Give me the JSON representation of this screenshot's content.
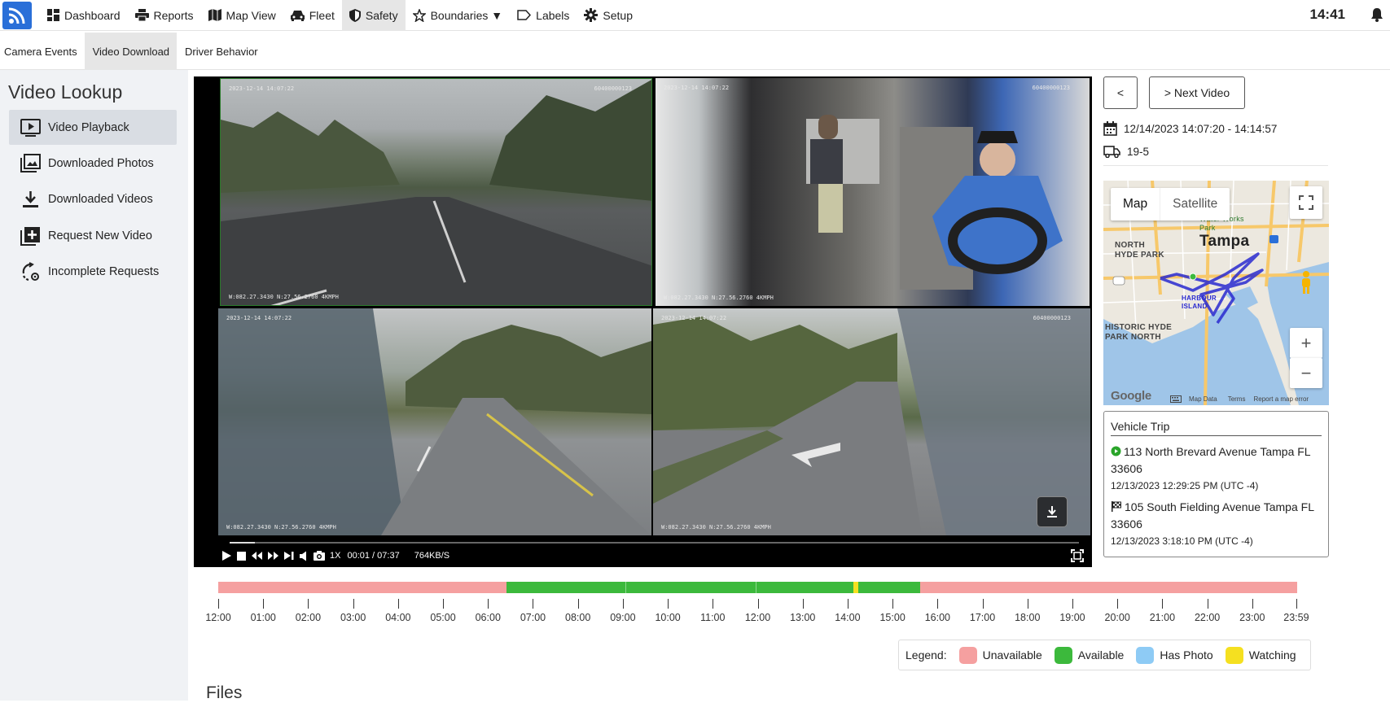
{
  "nav": {
    "items": [
      {
        "label": "Dashboard",
        "icon": "dashboard-icon"
      },
      {
        "label": "Reports",
        "icon": "printer-icon"
      },
      {
        "label": "Map View",
        "icon": "map-icon"
      },
      {
        "label": "Fleet",
        "icon": "car-icon"
      },
      {
        "label": "Safety",
        "icon": "shield-icon"
      },
      {
        "label": "Boundaries ▼",
        "icon": "star-icon"
      },
      {
        "label": "Labels",
        "icon": "tag-icon"
      },
      {
        "label": "Setup",
        "icon": "gear-icon"
      }
    ],
    "active": "Safety",
    "clock": "14:41"
  },
  "subnav": {
    "tabs": [
      "Camera Events",
      "Video Download",
      "Driver Behavior"
    ],
    "active": "Video Download"
  },
  "sidebar": {
    "title": "Video Lookup",
    "items": [
      {
        "label": "Video Playback",
        "icon": "video-playback-icon"
      },
      {
        "label": "Downloaded Photos",
        "icon": "photos-icon"
      },
      {
        "label": "Downloaded Videos",
        "icon": "download-icon"
      },
      {
        "label": "Request New Video",
        "icon": "add-icon"
      },
      {
        "label": "Incomplete Requests",
        "icon": "incomplete-icon"
      }
    ],
    "active": "Video Playback"
  },
  "video": {
    "cameras": [
      {
        "timestamp": "2023-12-14 14:07:22",
        "camera_id": "60400000123",
        "gps": "W:082.27.3430 N:27.56.2760 4KMPH"
      },
      {
        "timestamp": "2023-12-14 14:07:22",
        "camera_id": "60400000123",
        "gps": "W:082.27.3430 N:27.56.2760 4KMPH"
      },
      {
        "timestamp": "2023-12-14 14:07:22",
        "camera_id": "",
        "gps": "W:082.27.3430 N:27.56.2760 4KMPH"
      },
      {
        "timestamp": "2023-12-14 14:07:22",
        "camera_id": "60400000123",
        "gps": "W:082.27.3430 N:27.56.2760 4KMPH"
      }
    ],
    "speed": "1X",
    "time": "00:01 / 07:37",
    "bitrate": "764KB/S",
    "progress_fraction": 0.03
  },
  "right_panel": {
    "prev_label": "<",
    "next_label": "> Next Video",
    "date_range": "12/14/2023 14:07:20 - 14:14:57",
    "vehicle": "19-5"
  },
  "map": {
    "tab_map": "Map",
    "tab_satellite": "Satellite",
    "labels": [
      "Tampa",
      "NORTH HYDE PARK",
      "HISTORIC HYDE PARK NORTH",
      "Water Works Park",
      "HARBOUR ISLAND"
    ],
    "footer": [
      "Map Data",
      "Terms",
      "Report a map error"
    ],
    "google": "Google",
    "route_color": "#2a2ad0"
  },
  "trip": {
    "title": "Vehicle Trip",
    "start_address": "113 North Brevard Avenue Tampa FL 33606",
    "start_time": "12/13/2023 12:29:25 PM (UTC -4)",
    "end_address": "105 South Fielding Avenue Tampa FL 33606",
    "end_time": "12/13/2023 3:18:10 PM (UTC -4)"
  },
  "timeline": {
    "labels": [
      "12:00",
      "01:00",
      "02:00",
      "03:00",
      "04:00",
      "05:00",
      "06:00",
      "07:00",
      "08:00",
      "09:00",
      "10:00",
      "11:00",
      "12:00",
      "13:00",
      "14:00",
      "15:00",
      "16:00",
      "17:00",
      "18:00",
      "19:00",
      "20:00",
      "21:00",
      "22:00",
      "23:00",
      "23:59"
    ],
    "segments": [
      {
        "from_hour": 0,
        "to_hour": 6.42,
        "status": "unavailable"
      },
      {
        "from_hour": 6.42,
        "to_hour": 14.12,
        "status": "available"
      },
      {
        "from_hour": 14.12,
        "to_hour": 14.24,
        "status": "watching"
      },
      {
        "from_hour": 14.24,
        "to_hour": 15.62,
        "status": "available"
      },
      {
        "from_hour": 15.62,
        "to_hour": 24,
        "status": "unavailable"
      }
    ],
    "colors": {
      "unavailable": "#f5a0a0",
      "available": "#3cb93c",
      "has_photo": "#8ecbf5",
      "watching": "#f5e020"
    }
  },
  "legend": {
    "title": "Legend:",
    "items": [
      {
        "label": "Unavailable",
        "color": "#f5a0a0"
      },
      {
        "label": "Available",
        "color": "#3cb93c"
      },
      {
        "label": "Has Photo",
        "color": "#8ecbf5"
      },
      {
        "label": "Watching",
        "color": "#f5e020"
      }
    ]
  },
  "files_title": "Files"
}
